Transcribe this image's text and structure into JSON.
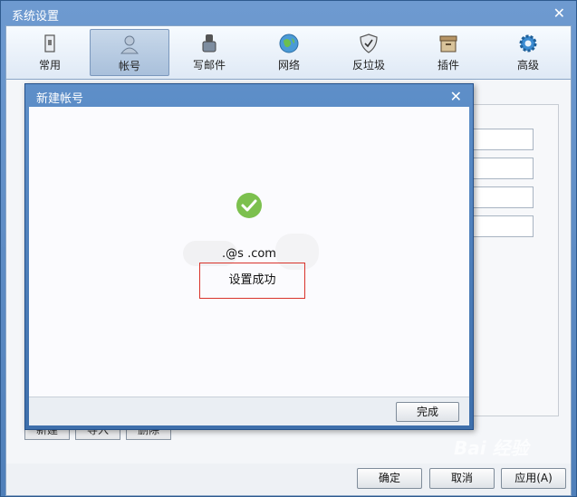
{
  "window": {
    "title": "系统设置",
    "close": "✕"
  },
  "toolbar": {
    "items": [
      {
        "label": "常用",
        "icon": "general-icon"
      },
      {
        "label": "帐号",
        "icon": "account-icon",
        "active": true
      },
      {
        "label": "写邮件",
        "icon": "compose-icon"
      },
      {
        "label": "网络",
        "icon": "network-icon"
      },
      {
        "label": "反垃圾",
        "icon": "antispam-icon"
      },
      {
        "label": "插件",
        "icon": "plugin-icon"
      },
      {
        "label": "高级",
        "icon": "advanced-icon"
      }
    ]
  },
  "account_panel": {
    "buttons": {
      "new": "新建",
      "import": "导入",
      "delete": "删除"
    }
  },
  "dialog": {
    "title": "新建帐号",
    "close": "✕",
    "email": ".@s         .com",
    "success_message": "设置成功",
    "done_label": "完成"
  },
  "bottom": {
    "ok": "确定",
    "cancel": "取消",
    "apply": "应用(A)"
  },
  "watermark": "Bai 经验",
  "colors": {
    "title_bar": "#5e8fc9",
    "success_green": "#7cc04e",
    "highlight_box": "#d9332b"
  }
}
